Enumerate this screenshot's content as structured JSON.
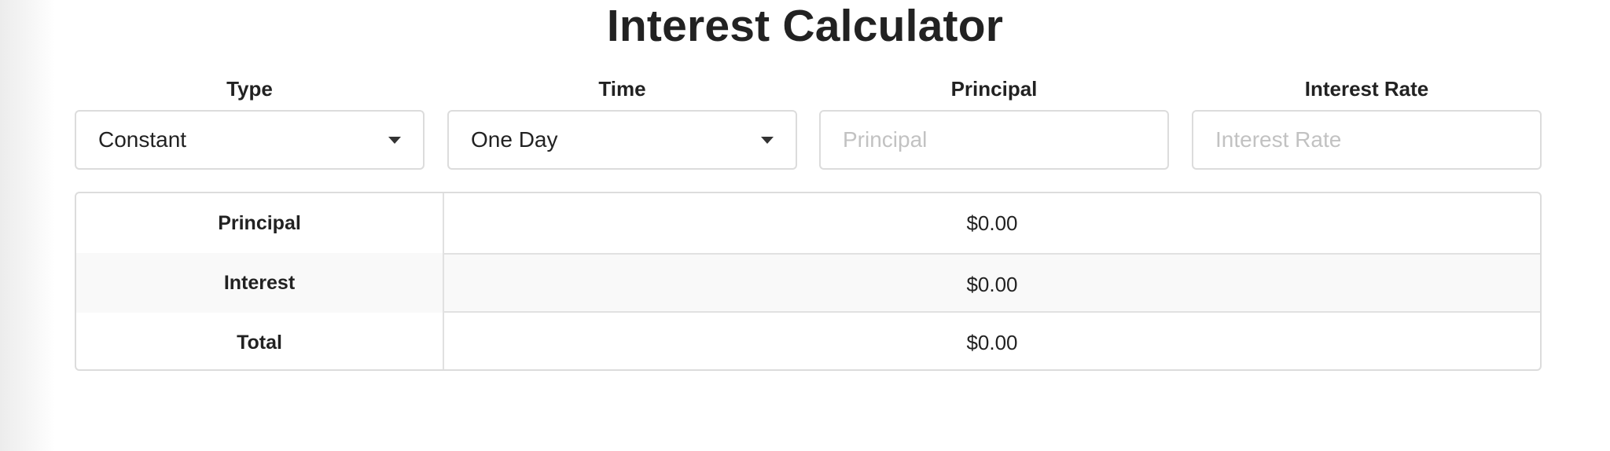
{
  "title": "Interest Calculator",
  "controls": {
    "type": {
      "label": "Type",
      "value": "Constant",
      "icon": "caret-down-icon"
    },
    "time": {
      "label": "Time",
      "value": "One Day",
      "icon": "caret-down-icon"
    },
    "principal": {
      "label": "Principal",
      "placeholder": "Principal",
      "value": ""
    },
    "interest_rate": {
      "label": "Interest Rate",
      "placeholder": "Interest Rate",
      "value": ""
    }
  },
  "results": [
    {
      "label": "Principal",
      "value": "$0.00"
    },
    {
      "label": "Interest",
      "value": "$0.00"
    },
    {
      "label": "Total",
      "value": "$0.00"
    }
  ],
  "colors": {
    "text": "#222222",
    "border": "#dcdcdc",
    "placeholder": "#c2c2c2",
    "striped_row": "#f9f9f9"
  }
}
